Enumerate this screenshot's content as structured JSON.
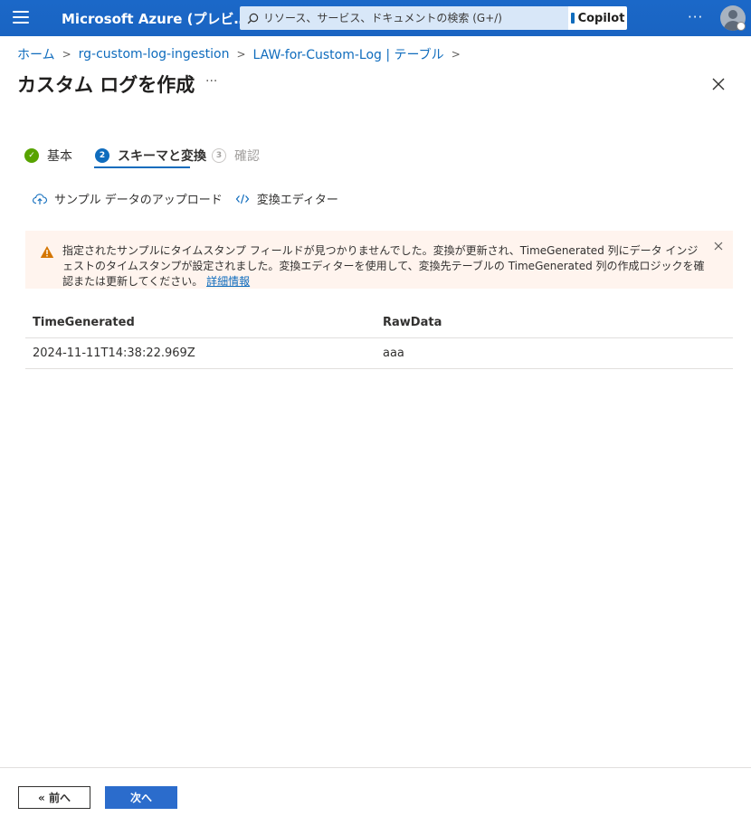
{
  "topbar": {
    "brand": "Microsoft Azure (プレビ…",
    "search_placeholder": "リソース、サービス、ドキュメントの検索 (G+/)",
    "copilot_label": "Copilot",
    "more_label": "···"
  },
  "breadcrumb": {
    "items": [
      "ホーム",
      "rg-custom-log-ingestion",
      "LAW-for-Custom-Log | テーブル"
    ]
  },
  "page": {
    "title": "カスタム ログを作成",
    "more_label": "···"
  },
  "wizard": {
    "tabs": [
      {
        "label": "基本",
        "state": "completed",
        "step": "✓"
      },
      {
        "label": "スキーマと変換",
        "state": "active",
        "step": "2"
      },
      {
        "label": "確認",
        "state": "disabled",
        "step": "3"
      }
    ]
  },
  "toolbar": {
    "upload_label": "サンプル データのアップロード",
    "editor_label": "変換エディター"
  },
  "warning": {
    "message": "指定されたサンプルにタイムスタンプ フィールドが見つかりませんでした。変換が更新され、TimeGenerated 列にデータ インジェストのタイムスタンプが設定されました。変換エディターを使用して、変換先テーブルの TimeGenerated 列の作成ロジックを確認または更新してください。",
    "link": "詳細情報"
  },
  "table": {
    "columns": [
      "TimeGenerated",
      "RawData"
    ],
    "rows": [
      [
        "2024-11-11T14:38:22.969Z",
        "aaa"
      ]
    ]
  },
  "footer": {
    "prev_label": "« 前へ",
    "next_label": "次へ"
  },
  "colors": {
    "topbar": "#1b68c8",
    "accent": "#0f6cbd",
    "success": "#57a300",
    "warning_bg": "#fff4ee",
    "warning_icon": "#d47500"
  },
  "icons": {
    "menu": "hamburger-icon",
    "search": "search-icon",
    "close": "close-icon",
    "upload": "cloud-upload-icon",
    "editor": "code-icon",
    "warning": "warning-icon"
  }
}
